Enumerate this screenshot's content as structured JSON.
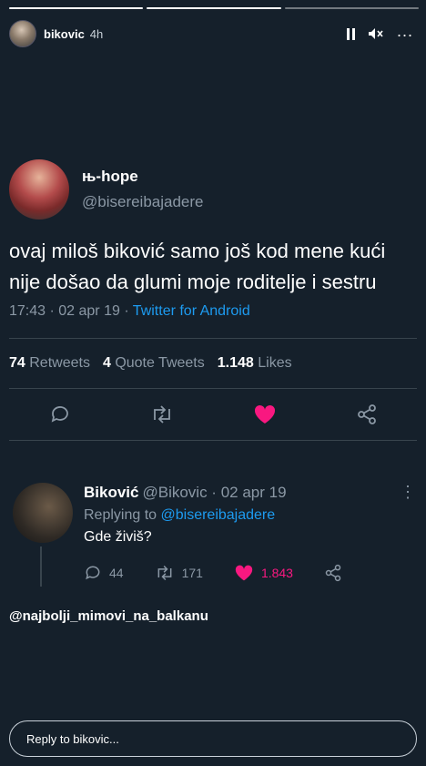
{
  "story": {
    "username": "bikovic",
    "time": "4h",
    "progress_segments": 3,
    "progress_done": 2
  },
  "tweet": {
    "display_name": "њ-hope",
    "handle": "@bisereibajadere",
    "text": "ovaj miloš biković samo još kod mene kući nije došao da glumi moje roditelje i sestru",
    "timestamp": "17:43 · 02 apr 19 · ",
    "source": "Twitter for Android",
    "retweets_count": "74",
    "retweets_label": "Retweets",
    "quote_count": "4",
    "quote_label": "Quote Tweets",
    "likes_count": "1.148",
    "likes_label": "Likes"
  },
  "reply": {
    "display_name": "Biković",
    "handle_date": "@Bikovic · 02 apr 19",
    "replying_prefix": "Replying to",
    "replying_to": "@bisereibajadere",
    "text": "Gde živiš?",
    "reply_count": "44",
    "retweet_count": "171",
    "like_count": "1.843"
  },
  "caption": "@najbolji_mimovi_na_balkanu",
  "reply_bar": {
    "placeholder": "Reply to bikovic..."
  },
  "colors": {
    "background": "#15202b",
    "accent_blue": "#1d9bf0",
    "like_pink": "#f91880",
    "muted_text": "#8b98a5"
  },
  "icons": [
    "pause-icon",
    "mute-icon",
    "more-icon",
    "reply-icon",
    "retweet-icon",
    "heart-icon",
    "share-icon"
  ]
}
